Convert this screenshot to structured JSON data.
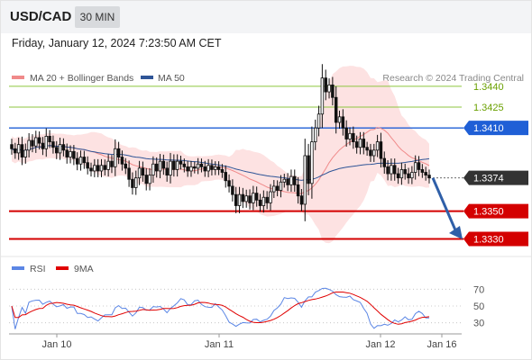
{
  "header": {
    "symbol": "USD/CAD",
    "timeframe": "30 MIN"
  },
  "timestamp": "Friday, January 12, 2024 7:23:50 AM CET",
  "legend": [
    {
      "label": "MA 20 + Bollinger Bands",
      "color": "#f08a8a"
    },
    {
      "label": "MA 50",
      "color": "#2f5597"
    }
  ],
  "copyright": "Research © 2024 Trading Central",
  "colors": {
    "resistance_green": "#8dc63f",
    "pivot_blue": "#1f5fd6",
    "support_red": "#d40000",
    "arrow": "#2f5fa8",
    "candle": "#111111",
    "bollinger_fill": "#fde2e2",
    "ma20": "#f08a8a",
    "ma50": "#2f5597",
    "rsi": "#5b86e5",
    "rsi_ma": "#e00000"
  },
  "chart_data": [
    {
      "type": "candlestick",
      "ylim": [
        1.3318,
        1.3462
      ],
      "levels": [
        {
          "value": 1.344,
          "label": "1.3440",
          "kind": "resistance",
          "color": "#6aa000",
          "badge": false
        },
        {
          "value": 1.3425,
          "label": "1.3425",
          "kind": "resistance",
          "color": "#6aa000",
          "badge": false
        },
        {
          "value": 1.341,
          "label": "1.3410",
          "kind": "pivot",
          "color": "#1f5fd6",
          "badge": true
        },
        {
          "value": 1.3374,
          "label": "1.3374",
          "kind": "last-price",
          "color": "#333333",
          "badge": true
        },
        {
          "value": 1.335,
          "label": "1.3350",
          "kind": "support",
          "color": "#d40000",
          "badge": true
        },
        {
          "value": 1.333,
          "label": "1.3330",
          "kind": "support",
          "color": "#d40000",
          "badge": true
        }
      ],
      "x_labels": [
        "Jan 10",
        "Jan 11",
        "Jan 12",
        "Jan 16"
      ],
      "close": [
        1.3395,
        1.3392,
        1.3398,
        1.3389,
        1.3394,
        1.3401,
        1.3397,
        1.3403,
        1.3399,
        1.3395,
        1.3404,
        1.34,
        1.3396,
        1.3392,
        1.3398,
        1.3394,
        1.3389,
        1.3393,
        1.3388,
        1.3384,
        1.3389,
        1.3385,
        1.3381,
        1.3379,
        1.3383,
        1.3379,
        1.3383,
        1.338,
        1.3386,
        1.3382,
        1.3395,
        1.3389,
        1.3384,
        1.3381,
        1.3373,
        1.3367,
        1.3374,
        1.3381,
        1.3376,
        1.337,
        1.3376,
        1.3384,
        1.3379,
        1.3386,
        1.3381,
        1.3376,
        1.3386,
        1.338,
        1.3386,
        1.3384,
        1.3382,
        1.3379,
        1.3382,
        1.3381,
        1.3384,
        1.3382,
        1.3379,
        1.3383,
        1.338,
        1.3382,
        1.338,
        1.3378,
        1.3372,
        1.3368,
        1.3362,
        1.3354,
        1.3362,
        1.3357,
        1.3361,
        1.3356,
        1.3363,
        1.3358,
        1.3354,
        1.336,
        1.3356,
        1.3364,
        1.3368,
        1.3365,
        1.3371,
        1.3373,
        1.3369,
        1.3375,
        1.3369,
        1.3361,
        1.3355,
        1.339,
        1.337,
        1.34,
        1.341,
        1.342,
        1.3446,
        1.3436,
        1.3441,
        1.3432,
        1.3414,
        1.3418,
        1.341,
        1.3402,
        1.3406,
        1.34,
        1.3396,
        1.3402,
        1.3396,
        1.3394,
        1.339,
        1.3394,
        1.34,
        1.3388,
        1.3382,
        1.3377,
        1.3383,
        1.3377,
        1.3374,
        1.338,
        1.3377,
        1.3374,
        1.3378,
        1.3385,
        1.338,
        1.3378,
        1.3376,
        1.3374
      ]
    },
    {
      "type": "line",
      "panel": "RSI",
      "series": [
        {
          "name": "RSI",
          "color": "#5b86e5"
        },
        {
          "name": "9MA",
          "color": "#e00000"
        }
      ],
      "ylim": [
        20,
        80
      ],
      "yticks": [
        30,
        50,
        70
      ]
    }
  ]
}
